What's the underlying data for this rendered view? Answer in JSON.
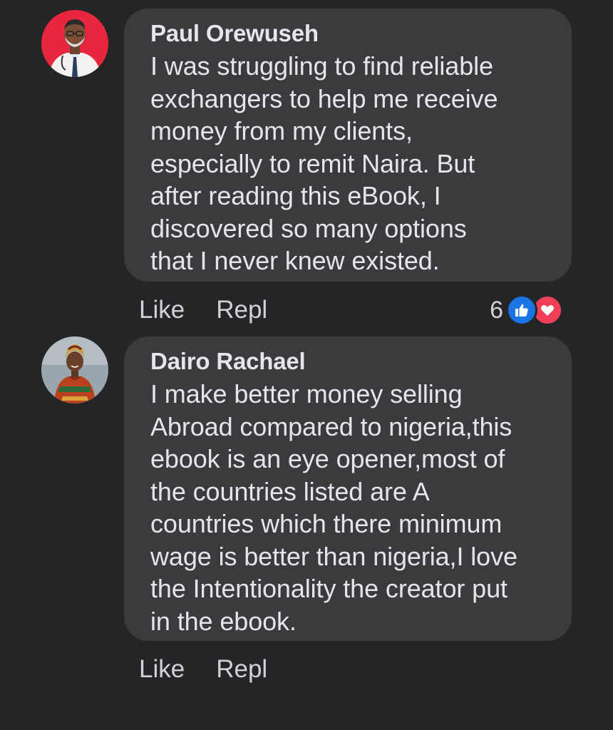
{
  "comments": [
    {
      "author": "Paul Orewuseh",
      "text": "I was struggling to find reliable\nexchangers to help me receive\nmoney from my clients,\nespecially to remit Naira. But\nafter reading this eBook, I\ndiscovered so many options\nthat I never knew existed.",
      "like_label": "Like",
      "reply_label": "Repl",
      "reaction_count": "6",
      "reactions": [
        "like-icon",
        "love-icon"
      ],
      "avatar_bg": "#e8263d"
    },
    {
      "author": "Dairo Rachael",
      "text": "I make better money selling\nAbroad compared to nigeria,this\nebook is an eye opener,most of\nthe countries listed are A\ncountries which there minimum\nwage is better than nigeria,I love\nthe Intentionality the creator put\nin the ebook.",
      "like_label": "Like",
      "reply_label": "Repl",
      "avatar_bg": "#9aa6ae"
    }
  ],
  "colors": {
    "background": "#242526",
    "bubble": "#3a3b3c",
    "text": "#e4e6eb",
    "like_blue": "#1b74e4",
    "love_red": "#f33e58"
  }
}
